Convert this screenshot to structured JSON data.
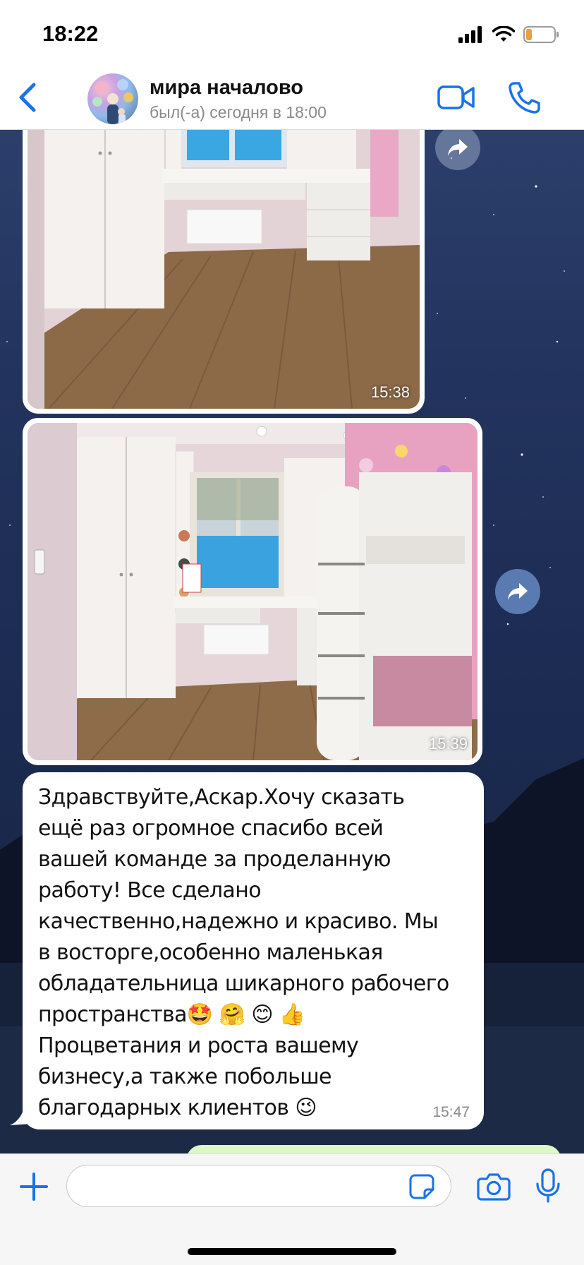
{
  "status_bar": {
    "time": "18:22"
  },
  "header": {
    "contact_name": "мира началово",
    "last_seen": "был(-а) сегодня в 18:00"
  },
  "messages": [
    {
      "type": "image",
      "time": "15:38"
    },
    {
      "type": "image",
      "time": "15:39"
    },
    {
      "type": "text",
      "text": "Здравствуйте,Аскар.Хочу сказать\nещё раз огромное спасибо всей\nвашей команде за проделанную\nработу! Все сделано\nкачественно,надежно и красиво. Мы\nв восторге,особенно маленькая\nобладательница шикарного рабочего\nпространства🤩 🤗 😊 👍\nПроцветания и роста вашему\nбизнесу,а также побольше\nблагодарных клиентов 😉",
      "time": "15:47"
    }
  ],
  "input": {
    "value": "",
    "placeholder": ""
  },
  "icons": {
    "back": "chevron-left-icon",
    "video": "video-camera-icon",
    "call": "phone-icon",
    "forward": "forward-arrow-icon",
    "plus": "plus-icon",
    "sticker": "sticker-icon",
    "camera": "camera-icon",
    "mic": "microphone-icon"
  },
  "colors": {
    "accent": "#1a73e8",
    "incoming_bubble": "#ffffff",
    "outgoing_bubble": "#dcf8c6"
  }
}
